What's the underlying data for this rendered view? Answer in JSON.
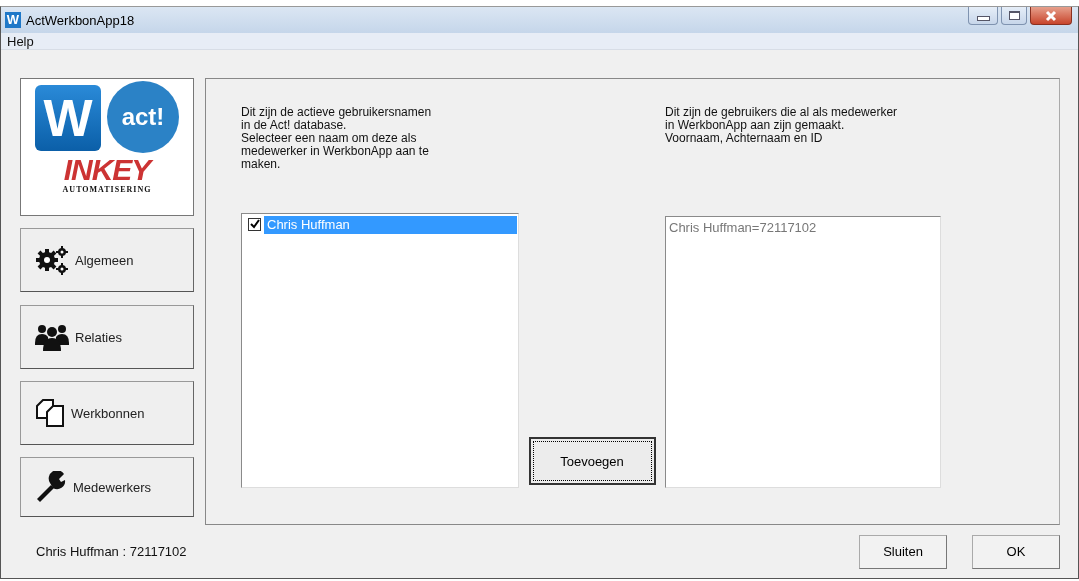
{
  "window": {
    "title": "ActWerkbonApp18",
    "icon_letter": "W"
  },
  "menu": [
    "Help"
  ],
  "logo": {
    "w_letter": "W",
    "act_text": "act!",
    "inkey_text": "INKEY",
    "inkey_sub": "AUTOMATISERING"
  },
  "nav_buttons": [
    {
      "label": "Algemeen",
      "kind": "gears"
    },
    {
      "label": "Relaties",
      "kind": "people"
    },
    {
      "label": "Werkbonnen",
      "kind": "pages"
    },
    {
      "label": "Medewerkers",
      "kind": "wrench"
    }
  ],
  "left_pane": {
    "description": "Dit zijn de actieve gebruikersnamen in de Act! database.\nSelecteer een naam om deze als medewerker in WerkbonApp aan te maken.",
    "items": [
      {
        "label": "Chris Huffman",
        "checked": true,
        "selected": true
      }
    ]
  },
  "add_button": "Toevoegen",
  "right_pane": {
    "description": "Dit zijn de gebruikers die al als medewerker\nin WerkbonApp aan zijn gemaakt.\nVoornaam, Achternaam en ID",
    "lines": [
      "Chris Huffman=72117102"
    ]
  },
  "status": "Chris Huffman : 72117102",
  "buttons": [
    "Sluiten",
    "OK"
  ]
}
